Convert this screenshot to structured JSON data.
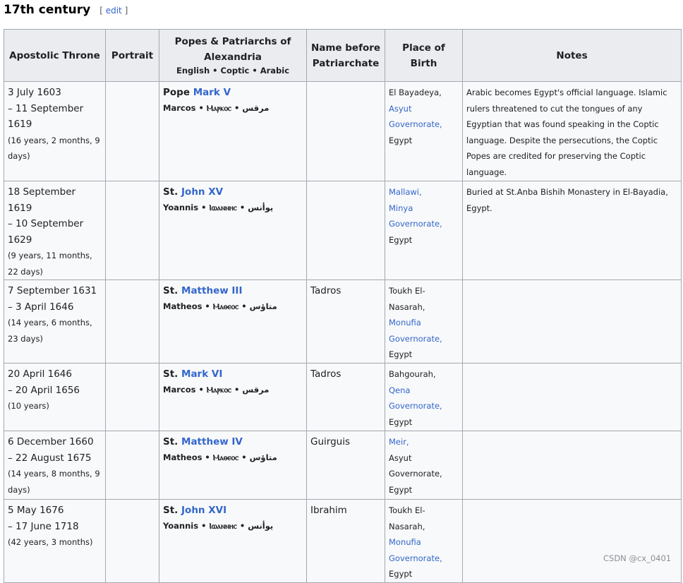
{
  "heading": {
    "title": "17th century",
    "edit_open": "[ ",
    "edit_link": "edit",
    "edit_close": " ]"
  },
  "headers": {
    "apostolic_throne": "Apostolic Throne",
    "portrait": "Portrait",
    "popes_line1": "Popes & Patriarchs of",
    "popes_line2": "Alexandria",
    "popes_sub": "English • Coptic • Arabic",
    "name_before_line1": "Name before",
    "name_before_line2": "Patriarchate",
    "place_of_birth": "Place of Birth",
    "notes": "Notes"
  },
  "rows": [
    {
      "date_start": "3 July 1603",
      "date_end_line1": "– 11 September",
      "date_end_line2": "1619",
      "duration_line1": "(16 years, 2 months, 9",
      "duration_line2": "days)",
      "title_prefix": "Pope ",
      "pope_link": "Mark V",
      "pope_sub": "Marcos • Ⲙⲁⲣⲕⲟⲥ • مرقس",
      "name_before": "",
      "pob_1": "El Bayadeya,",
      "pob_2": "Asyut",
      "pob_3": "Governorate,",
      "pob_4": "Egypt",
      "notes_1": "Arabic becomes Egypt's official language. Islamic",
      "notes_2": "rulers threatened to cut the tongues of any",
      "notes_3": "Egyptian that was found speaking in the Coptic",
      "notes_4": "language. Despite the persecutions, the Coptic",
      "notes_5": "Popes are credited for preserving the Coptic",
      "notes_6": "language."
    },
    {
      "date_start": "18 September 1619",
      "date_end_line1": "– 10 September",
      "date_end_line2": "1629",
      "duration_line1": "(9 years, 11 months,",
      "duration_line2": "22 days)",
      "title_prefix": "St. ",
      "pope_link": "John XV",
      "pope_sub": "Yoannis • Ⲓⲱⲁⲛⲛⲏⲥ • يوأنس",
      "name_before": "",
      "pob_1": "Mallawi,",
      "pob_2": "Minya",
      "pob_3": "Governorate,",
      "pob_4": "Egypt",
      "notes_1": "Buried at St.Anba Bishih Monastery in El-Bayadia,",
      "notes_2": "Egypt."
    },
    {
      "date_start": "7 September 1631",
      "date_end_line1": "– 3 April 1646",
      "duration_line1": "(14 years, 6 months,",
      "duration_line2": "23 days)",
      "title_prefix": "St. ",
      "pope_link": "Matthew III",
      "pope_sub": "Matheos • Ⲙⲁⲑⲉⲟⲥ • متاؤس",
      "name_before": "Tadros",
      "pob_1": "Toukh El-",
      "pob_2": "Nasarah,",
      "pob_3": "Monufia",
      "pob_4": "Governorate,",
      "pob_5": "Egypt"
    },
    {
      "date_start": "20 April 1646",
      "date_end_line1": "– 20 April 1656",
      "duration_line1": "(10 years)",
      "title_prefix": "St. ",
      "pope_link": "Mark VI",
      "pope_sub": "Marcos • Ⲙⲁⲣⲕⲟⲥ • مرقس",
      "name_before": "Tadros",
      "pob_1": "Bahgourah,",
      "pob_2": "Qena",
      "pob_3": "Governorate,",
      "pob_4": "Egypt"
    },
    {
      "date_start": "6 December 1660",
      "date_end_line1": "– 22 August 1675",
      "duration_line1": "(14 years, 8 months, 9",
      "duration_line2": "days)",
      "title_prefix": "St. ",
      "pope_link": "Matthew IV",
      "pope_sub": "Matheos • Ⲙⲁⲑⲉⲟⲥ • متاؤس",
      "name_before": "Guirguis",
      "pob_1": "Meir,",
      "pob_2": "Asyut",
      "pob_3": "Governorate,",
      "pob_4": "Egypt"
    },
    {
      "date_start": "5 May 1676",
      "date_end_line1": "– 17 June 1718",
      "duration_line1": "(42 years, 3 months)",
      "title_prefix": "St. ",
      "pope_link": "John XVI",
      "pope_sub": "Yoannis • Ⲓⲱⲁⲛⲛⲏⲥ • يوأنس",
      "name_before": "Ibrahim",
      "pob_1": "Toukh El-",
      "pob_2": "Nasarah,",
      "pob_3": "Monufia",
      "pob_4": "Governorate,",
      "pob_5": "Egypt"
    }
  ],
  "watermark": "CSDN @cx_0401"
}
